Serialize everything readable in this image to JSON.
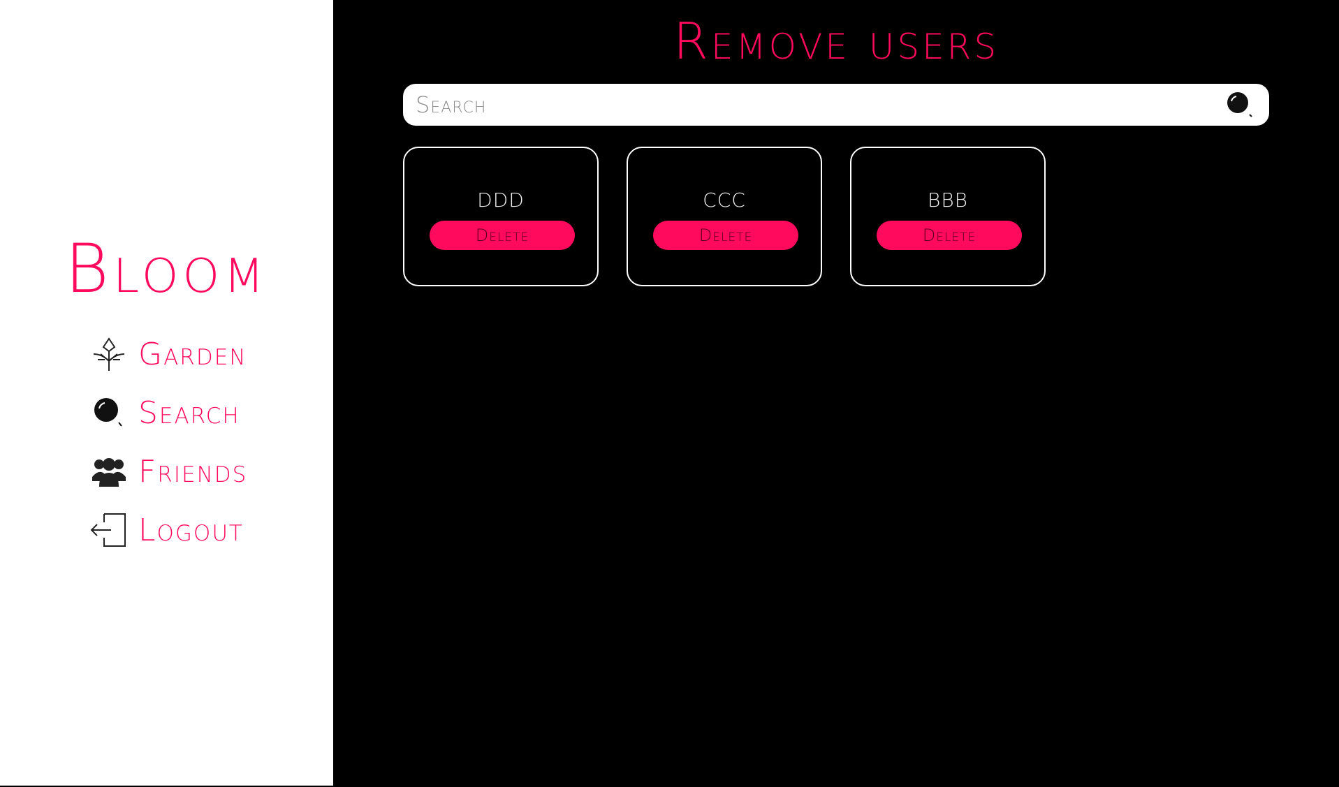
{
  "app": {
    "brand": "Bloom"
  },
  "sidebar": {
    "items": [
      {
        "label": "Garden",
        "icon": "garden-icon"
      },
      {
        "label": "Search",
        "icon": "search-icon"
      },
      {
        "label": "Friends",
        "icon": "friends-icon"
      },
      {
        "label": "Logout",
        "icon": "logout-icon"
      }
    ]
  },
  "main": {
    "title": "Remove users",
    "search": {
      "placeholder": "Search",
      "value": "",
      "icon": "search-icon"
    },
    "users": [
      {
        "name": "DDD",
        "action_label": "Delete"
      },
      {
        "name": "CCC",
        "action_label": "Delete"
      },
      {
        "name": "BBB",
        "action_label": "Delete"
      }
    ]
  },
  "colors": {
    "accent": "#ff0a5c",
    "sidebar_bg": "#ffffff",
    "main_bg": "#000000",
    "card_border": "#ffffff"
  }
}
